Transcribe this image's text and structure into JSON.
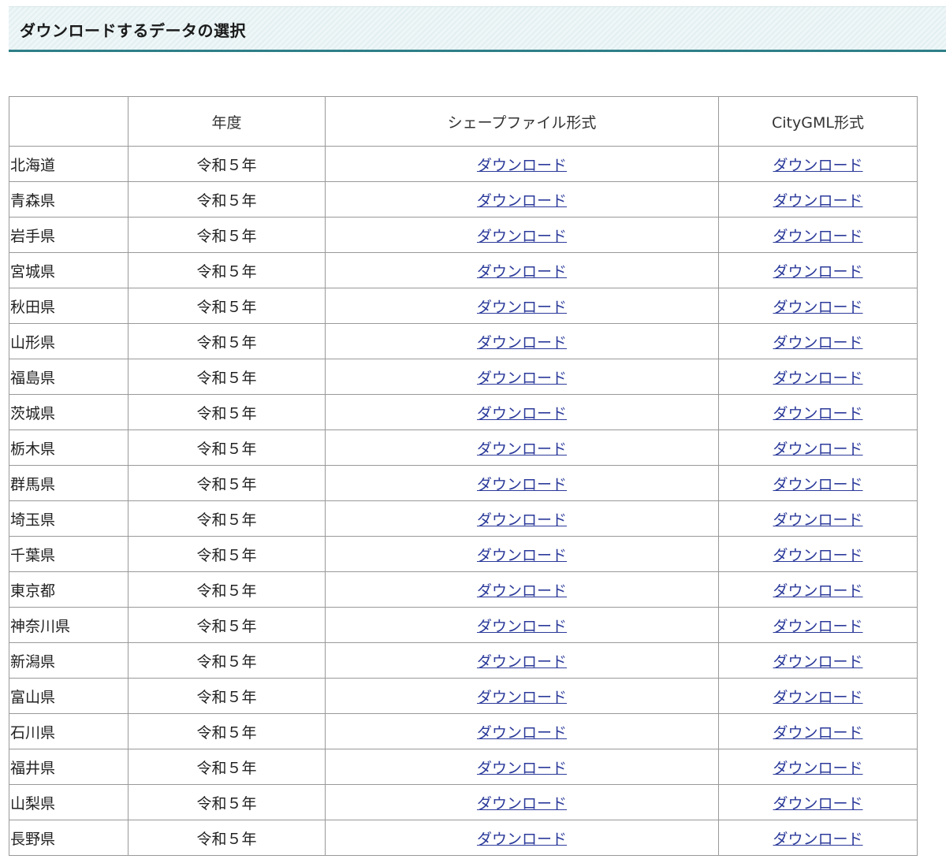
{
  "section": {
    "title": "ダウンロードするデータの選択"
  },
  "table": {
    "headers": [
      "",
      "年度",
      "シェープファイル形式",
      "CityGML形式"
    ],
    "rows": [
      {
        "pref": "北海道",
        "year": "令和５年",
        "shp": "ダウンロード",
        "gml": "ダウンロード"
      },
      {
        "pref": "青森県",
        "year": "令和５年",
        "shp": "ダウンロード",
        "gml": "ダウンロード"
      },
      {
        "pref": "岩手県",
        "year": "令和５年",
        "shp": "ダウンロード",
        "gml": "ダウンロード"
      },
      {
        "pref": "宮城県",
        "year": "令和５年",
        "shp": "ダウンロード",
        "gml": "ダウンロード"
      },
      {
        "pref": "秋田県",
        "year": "令和５年",
        "shp": "ダウンロード",
        "gml": "ダウンロード"
      },
      {
        "pref": "山形県",
        "year": "令和５年",
        "shp": "ダウンロード",
        "gml": "ダウンロード"
      },
      {
        "pref": "福島県",
        "year": "令和５年",
        "shp": "ダウンロード",
        "gml": "ダウンロード"
      },
      {
        "pref": "茨城県",
        "year": "令和５年",
        "shp": "ダウンロード",
        "gml": "ダウンロード"
      },
      {
        "pref": "栃木県",
        "year": "令和５年",
        "shp": "ダウンロード",
        "gml": "ダウンロード"
      },
      {
        "pref": "群馬県",
        "year": "令和５年",
        "shp": "ダウンロード",
        "gml": "ダウンロード"
      },
      {
        "pref": "埼玉県",
        "year": "令和５年",
        "shp": "ダウンロード",
        "gml": "ダウンロード"
      },
      {
        "pref": "千葉県",
        "year": "令和５年",
        "shp": "ダウンロード",
        "gml": "ダウンロード"
      },
      {
        "pref": "東京都",
        "year": "令和５年",
        "shp": "ダウンロード",
        "gml": "ダウンロード"
      },
      {
        "pref": "神奈川県",
        "year": "令和５年",
        "shp": "ダウンロード",
        "gml": "ダウンロード"
      },
      {
        "pref": "新潟県",
        "year": "令和５年",
        "shp": "ダウンロード",
        "gml": "ダウンロード"
      },
      {
        "pref": "富山県",
        "year": "令和５年",
        "shp": "ダウンロード",
        "gml": "ダウンロード"
      },
      {
        "pref": "石川県",
        "year": "令和５年",
        "shp": "ダウンロード",
        "gml": "ダウンロード"
      },
      {
        "pref": "福井県",
        "year": "令和５年",
        "shp": "ダウンロード",
        "gml": "ダウンロード"
      },
      {
        "pref": "山梨県",
        "year": "令和５年",
        "shp": "ダウンロード",
        "gml": "ダウンロード"
      },
      {
        "pref": "長野県",
        "year": "令和５年",
        "shp": "ダウンロード",
        "gml": "ダウンロード"
      }
    ]
  },
  "colors": {
    "accent": "#2e7f87",
    "link": "#2b3a9a",
    "border": "#999999"
  }
}
